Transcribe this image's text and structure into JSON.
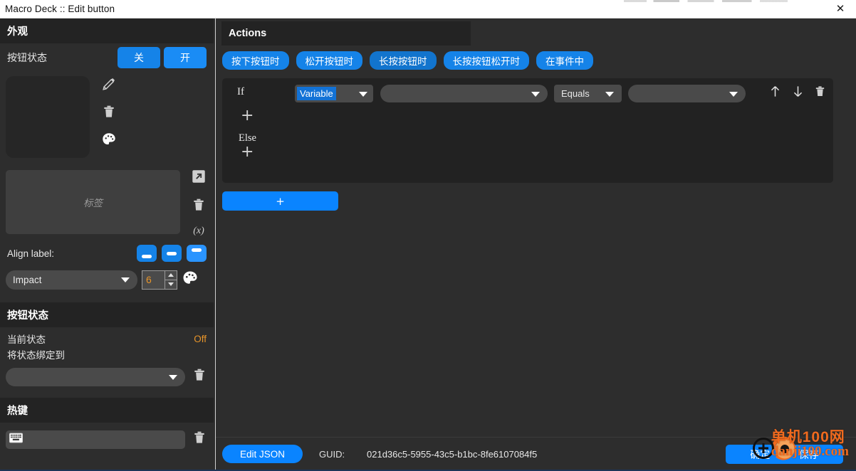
{
  "window": {
    "title": "Macro Deck :: Edit button",
    "close_icon": "close-icon"
  },
  "left_panel": {
    "appearance_header": "外观",
    "button_state_row": {
      "label": "按钮状态",
      "off_button": "关",
      "on_button": "开"
    },
    "preview": {
      "edit_icon": "pencil-icon",
      "delete_icon": "trash-icon",
      "color_icon": "palette-icon"
    },
    "label_editor": {
      "placeholder": "标签",
      "value": "",
      "expand_icon": "expand-arrow-icon",
      "delete_icon": "trash-icon",
      "variable_icon": "(x)"
    },
    "align": {
      "label": "Align label:",
      "options": [
        "bottom",
        "middle",
        "top"
      ],
      "selected": "top"
    },
    "font": {
      "family": "Impact",
      "size": "6",
      "color_icon": "palette-icon"
    },
    "state_section": {
      "header": "按钮状态",
      "current_state_label": "当前状态",
      "current_state_value": "Off",
      "bind_label": "将状态绑定到",
      "bind_value": "",
      "delete_icon": "trash-icon"
    },
    "hotkey_section": {
      "header": "热键",
      "input_value": "",
      "keyboard_icon": "keyboard-icon",
      "delete_icon": "trash-icon"
    }
  },
  "right_panel": {
    "header": "Actions",
    "tabs": [
      {
        "label": "按下按钮时",
        "active": false
      },
      {
        "label": "松开按钮时",
        "active": false
      },
      {
        "label": "长按按钮时",
        "active": true
      },
      {
        "label": "长按按钮松开时",
        "active": false
      },
      {
        "label": "在事件中",
        "active": false
      }
    ],
    "condition_block": {
      "if_label": "If",
      "variable_type": "Variable",
      "target_value": "",
      "operator": "Equals",
      "compare_value": "",
      "else_label": "Else",
      "add_if_icon": "plus-icon",
      "add_else_icon": "plus-icon",
      "move_up_icon": "arrow-up-icon",
      "move_down_icon": "arrow-down-icon",
      "delete_icon": "trash-icon"
    },
    "add_action_button": "+",
    "bottom_bar": {
      "edit_json_button": "Edit JSON",
      "guid_label": "GUID:",
      "guid_value": "021d36c5-5955-43c5-b1bc-8fe6107084f5",
      "confirm_button": "确定",
      "save_button": "保存"
    }
  },
  "watermark": {
    "cn": "单机100网",
    "en": "danji100.com"
  },
  "colors": {
    "accent_blue": "#1583e8",
    "button_blue": "#0a84ff",
    "state_orange": "#e8952a",
    "watermark_orange": "#f06a1e",
    "panel_bg": "#2d2d2d",
    "section_header_bg": "#232323",
    "input_bg": "#4a4a4a"
  }
}
